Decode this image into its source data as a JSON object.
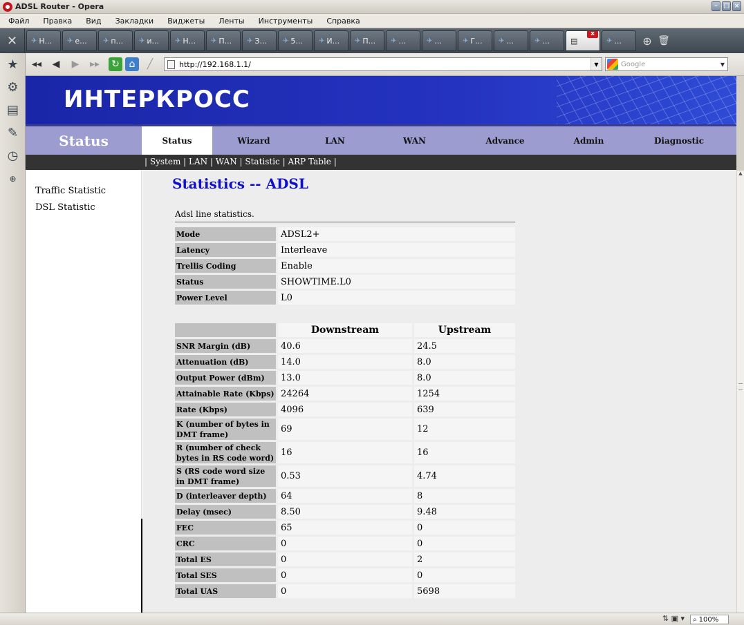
{
  "window": {
    "title": "ADSL Router - Opera"
  },
  "menu": [
    "Файл",
    "Правка",
    "Вид",
    "Закладки",
    "Виджеты",
    "Ленты",
    "Инструменты",
    "Справка"
  ],
  "tabs": [
    "Н...",
    "е...",
    "п...",
    "и...",
    "Н...",
    "П...",
    "З...",
    "5...",
    "И...",
    "П...",
    "...",
    "...",
    "Г...",
    "...",
    "...",
    "..."
  ],
  "address": {
    "url": "http://192.168.1.1/",
    "search_placeholder": "Google"
  },
  "router": {
    "logo": "ИНТЕРКРОСС",
    "section_title": "Status",
    "nav": [
      {
        "label": "Status",
        "active": true
      },
      {
        "label": "Wizard"
      },
      {
        "label": "LAN"
      },
      {
        "label": "WAN"
      },
      {
        "label": "Advance"
      },
      {
        "label": "Admin"
      },
      {
        "label": "Diagnostic"
      }
    ],
    "subnav": "| System | LAN | WAN | Statistic | ARP Table |",
    "left_menu": [
      "Traffic Statistic",
      "DSL Statistic"
    ],
    "heading": "Statistics -- ADSL",
    "description": "Adsl line statistics.",
    "line_info": [
      {
        "label": "Mode",
        "value": "ADSL2+"
      },
      {
        "label": "Latency",
        "value": "Interleave"
      },
      {
        "label": "Trellis Coding",
        "value": "Enable"
      },
      {
        "label": "Status",
        "value": "SHOWTIME.L0"
      },
      {
        "label": "Power Level",
        "value": "L0"
      }
    ],
    "stats_headers": {
      "downstream": "Downstream",
      "upstream": "Upstream"
    },
    "stats": [
      {
        "label": "SNR Margin (dB)",
        "down": "40.6",
        "up": "24.5"
      },
      {
        "label": "Attenuation (dB)",
        "down": "14.0",
        "up": "8.0"
      },
      {
        "label": "Output Power (dBm)",
        "down": "13.0",
        "up": "8.0"
      },
      {
        "label": "Attainable Rate (Kbps)",
        "down": "24264",
        "up": "1254"
      },
      {
        "label": "Rate (Kbps)",
        "down": "4096",
        "up": "639"
      },
      {
        "label": "K (number of bytes in DMT frame)",
        "down": "69",
        "up": "12"
      },
      {
        "label": "R (number of check bytes in RS code word)",
        "down": "16",
        "up": "16"
      },
      {
        "label": "S (RS code word size in DMT frame)",
        "down": "0.53",
        "up": "4.74"
      },
      {
        "label": "D (interleaver depth)",
        "down": "64",
        "up": "8"
      },
      {
        "label": "Delay (msec)",
        "down": "8.50",
        "up": "9.48"
      },
      {
        "label": "FEC",
        "down": "65",
        "up": "0"
      },
      {
        "label": "CRC",
        "down": "0",
        "up": "0"
      },
      {
        "label": "Total ES",
        "down": "0",
        "up": "2"
      },
      {
        "label": "Total SES",
        "down": "0",
        "up": "0"
      },
      {
        "label": "Total UAS",
        "down": "0",
        "up": "5698"
      }
    ]
  },
  "statusbar": {
    "zoom": "100%"
  }
}
